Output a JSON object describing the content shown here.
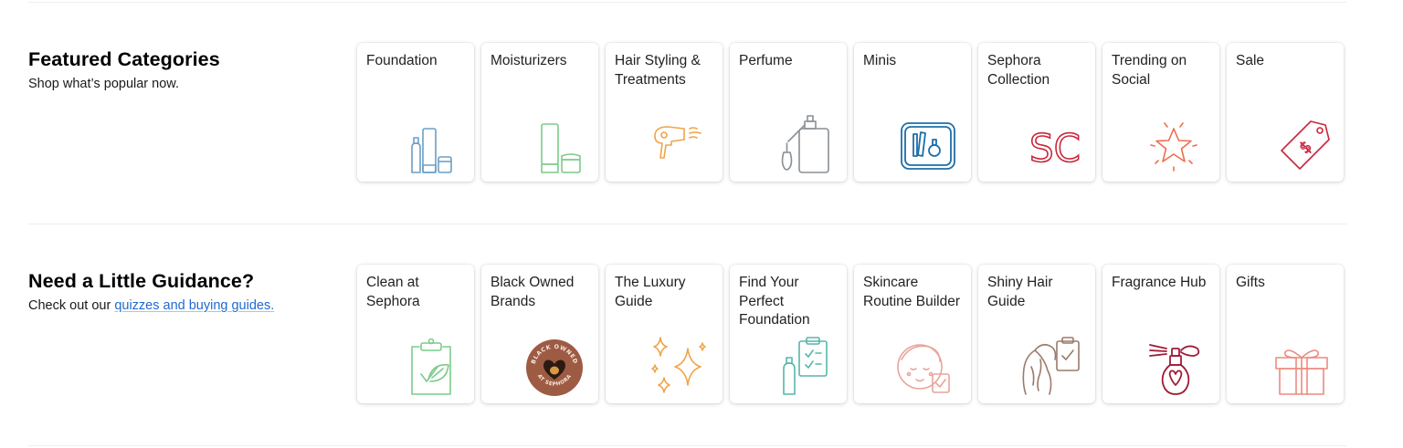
{
  "colors": {
    "blue_icon": "#6a9fc6",
    "green_icon": "#7ccb8a",
    "orange_icon": "#f0a448",
    "gray_icon": "#8a8f94",
    "navy_icon": "#1e6ea8",
    "red_icon": "#c8283c",
    "coral_icon": "#ee6e4e",
    "link": "#1f6ad1"
  },
  "featured": {
    "title": "Featured Categories",
    "subtitle": "Shop what’s popular now.",
    "tiles": [
      {
        "label": "Foundation",
        "icon": "foundation-bottles-icon"
      },
      {
        "label": "Moisturizers",
        "icon": "moisturizer-tube-jar-icon"
      },
      {
        "label": "Hair Styling & Treatments",
        "icon": "hair-dryer-icon"
      },
      {
        "label": "Perfume",
        "icon": "perfume-atomizer-icon"
      },
      {
        "label": "Minis",
        "icon": "minis-bag-icon"
      },
      {
        "label": "Sephora Collection",
        "icon": "sephora-collection-sc-icon",
        "icon_text": "SC"
      },
      {
        "label": "Trending on Social",
        "icon": "star-sparkle-icon"
      },
      {
        "label": "Sale",
        "icon": "sale-tag-icon",
        "icon_text": "$"
      }
    ]
  },
  "guidance": {
    "title": "Need a Little Guidance?",
    "subtitle_prefix": "Check out our ",
    "subtitle_link": "quizzes and buying guides.",
    "tiles": [
      {
        "label": "Clean at Sephora",
        "icon": "clipboard-leaf-icon"
      },
      {
        "label": "Black Owned Brands",
        "icon": "black-owned-badge-icon",
        "badge_top": "BLACK OWNED",
        "badge_bottom": "AT SEPHORA"
      },
      {
        "label": "The Luxury Guide",
        "icon": "sparkles-icon"
      },
      {
        "label": "Find Your Perfect Foundation",
        "icon": "foundation-checklist-icon"
      },
      {
        "label": "Skincare Routine Builder",
        "icon": "face-checklist-icon"
      },
      {
        "label": "Shiny Hair Guide",
        "icon": "hair-checklist-icon"
      },
      {
        "label": "Fragrance Hub",
        "icon": "fragrance-bottle-icon"
      },
      {
        "label": "Gifts",
        "icon": "gift-box-icon"
      }
    ]
  }
}
